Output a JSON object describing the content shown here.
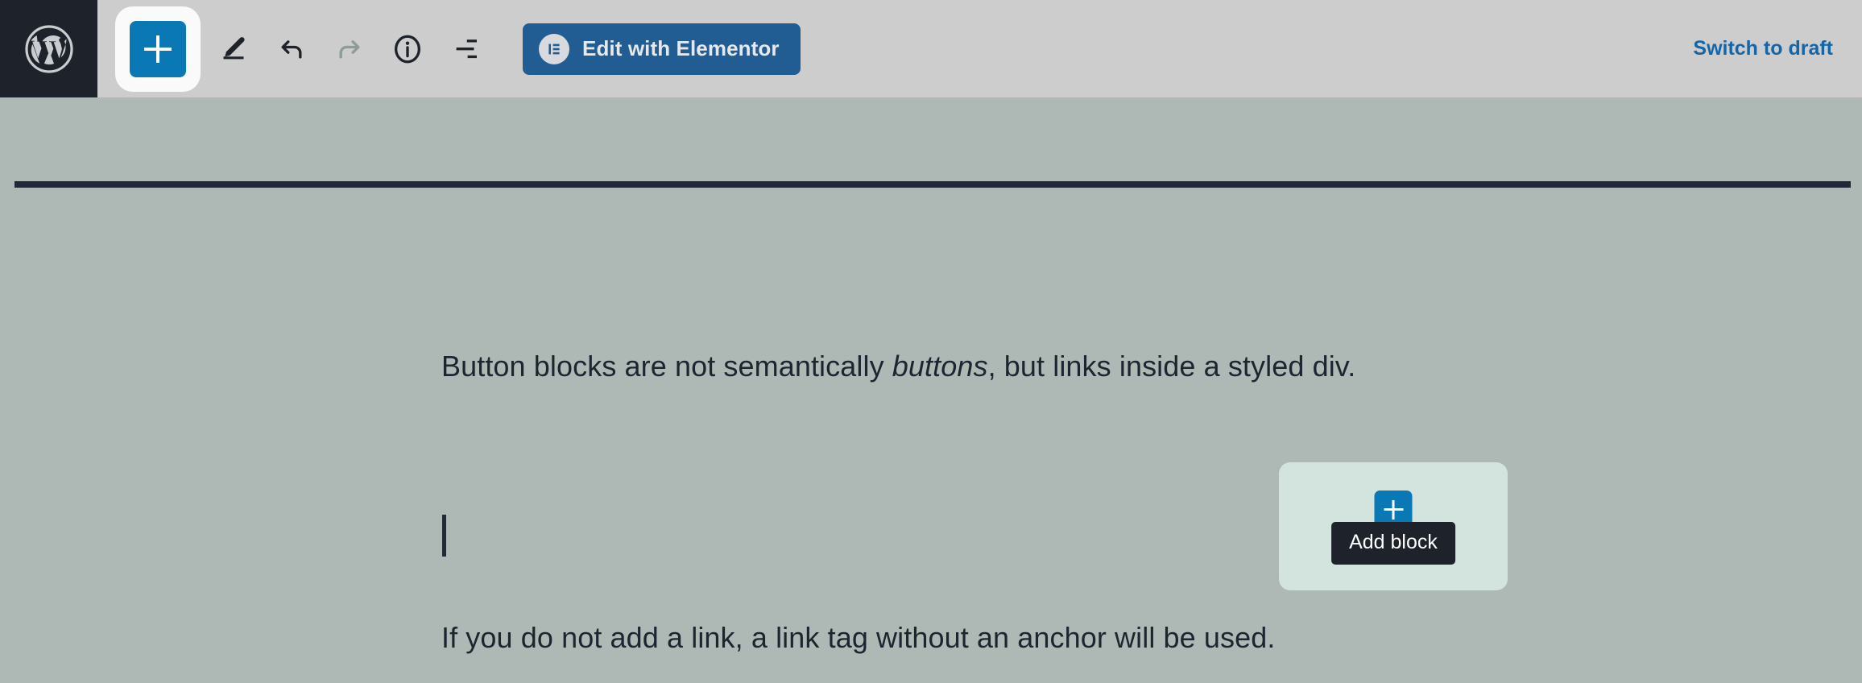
{
  "header": {
    "wp_logo_icon": "wordpress-logo-icon",
    "toolbar": {
      "inserter_label": "+",
      "inserter_name": "block-inserter-toggle",
      "tools": [
        {
          "name": "edit-pencil-icon",
          "title": "Edit",
          "state": "enabled"
        },
        {
          "name": "undo-icon",
          "title": "Undo",
          "state": "enabled"
        },
        {
          "name": "redo-icon",
          "title": "Redo",
          "state": "disabled"
        },
        {
          "name": "info-icon",
          "title": "Details",
          "state": "enabled"
        },
        {
          "name": "list-view-icon",
          "title": "Document Overview",
          "state": "enabled"
        }
      ]
    },
    "elementor_button": {
      "label": "Edit with Elementor",
      "icon": "elementor-logo-icon",
      "bg_color": "#215d92",
      "text_color": "#e6e8ea"
    },
    "switch_to_draft": {
      "label": "Switch to draft",
      "color": "#1566a8"
    },
    "bg_color": "#cdcdcd",
    "logo_bg_color": "#1e232b"
  },
  "canvas": {
    "bg_color": "#aeb9b5",
    "text_color": "#1e2430",
    "rule_color": "#212838",
    "blocks": [
      {
        "type": "paragraph",
        "text_before": "Button blocks are not semantically ",
        "text_emphasis": "buttons",
        "text_after": ", but links inside a styled div."
      },
      {
        "type": "paragraph",
        "text": "",
        "selected": true,
        "caret": true
      },
      {
        "type": "paragraph",
        "text": "If you do not add a link, a link tag without an anchor will be used."
      }
    ]
  },
  "block_appender": {
    "box_color": "#d3e3de",
    "button_color": "#0b78b6",
    "button_icon": "plus-icon",
    "tooltip_label": "Add block",
    "tooltip_bg": "#1e232b",
    "tooltip_color": "#ffffff"
  }
}
